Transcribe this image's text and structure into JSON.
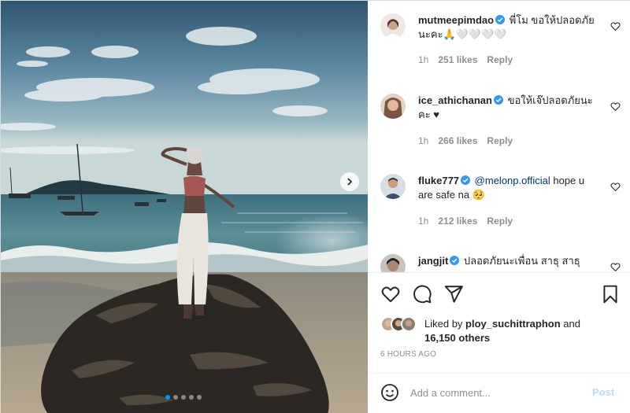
{
  "photo": {
    "alt": "",
    "carousel_count": 5,
    "carousel_active": 1
  },
  "comments": [
    {
      "username": "mutmeepimdao",
      "verified": true,
      "text": "พี่โม ขอให้ปลอดภัยนะคะ🙏🤍🤍🤍🤍",
      "time": "1h",
      "likes": "251 likes",
      "reply": "Reply"
    },
    {
      "username": "ice_athichanan",
      "verified": true,
      "text": "ขอให้เจ๊ปลอดภัยนะคะ ♥",
      "time": "1h",
      "likes": "266 likes",
      "reply": "Reply"
    },
    {
      "username": "fluke777",
      "verified": true,
      "mention": "@melonp.official",
      "text": "hope u are safe na 🥺",
      "time": "1h",
      "likes": "212 likes",
      "reply": "Reply"
    },
    {
      "username": "jangjit",
      "verified": true,
      "text": "ปลอดภัยนะเพื่อน สาธุ สาธุ"
    }
  ],
  "actions": {
    "like": "heart-icon",
    "comment": "comment-icon",
    "share": "paper-plane-icon",
    "save": "bookmark-icon"
  },
  "liked_by": {
    "prefix": "Liked by",
    "user": "ploy_suchittraphon",
    "and": "and",
    "others": "16,150 others"
  },
  "timestamp": "6 HOURS AGO",
  "add_comment": {
    "placeholder": "Add a comment...",
    "post_label": "Post"
  },
  "colors": {
    "verified": "#3897f0",
    "accent": "#0095f6",
    "post_disabled": "#b2dffc",
    "muted": "#8e8e8e"
  }
}
